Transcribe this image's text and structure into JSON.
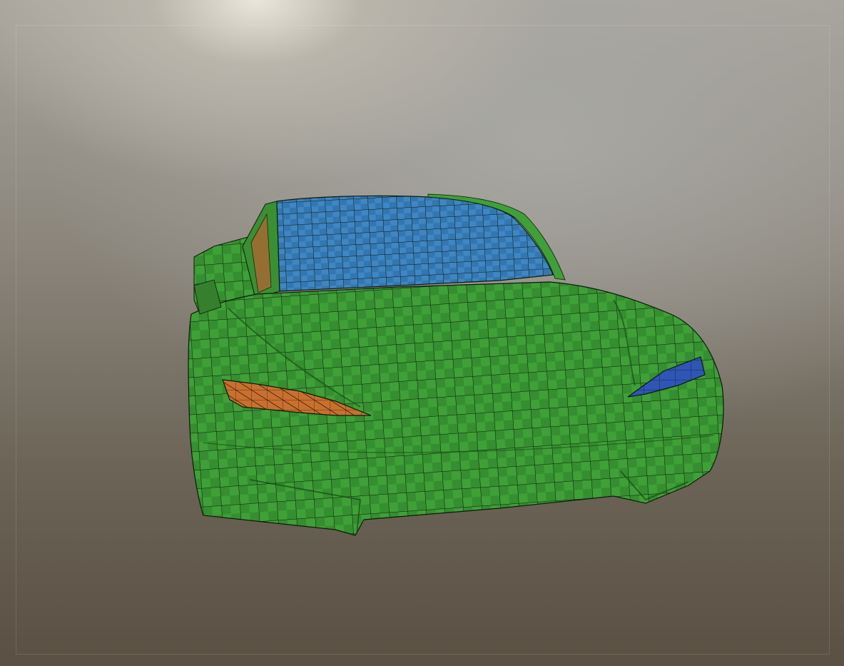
{
  "scene": {
    "model": "car-mesh",
    "colors": {
      "body": "#3f9f36",
      "body_checker": "#2d7a28",
      "glass": "#3f86c4",
      "glass_checker": "#2f6fa8",
      "left_light": "#c9702e",
      "right_light": "#2f55b5",
      "wire": "#0b1a0a"
    }
  }
}
